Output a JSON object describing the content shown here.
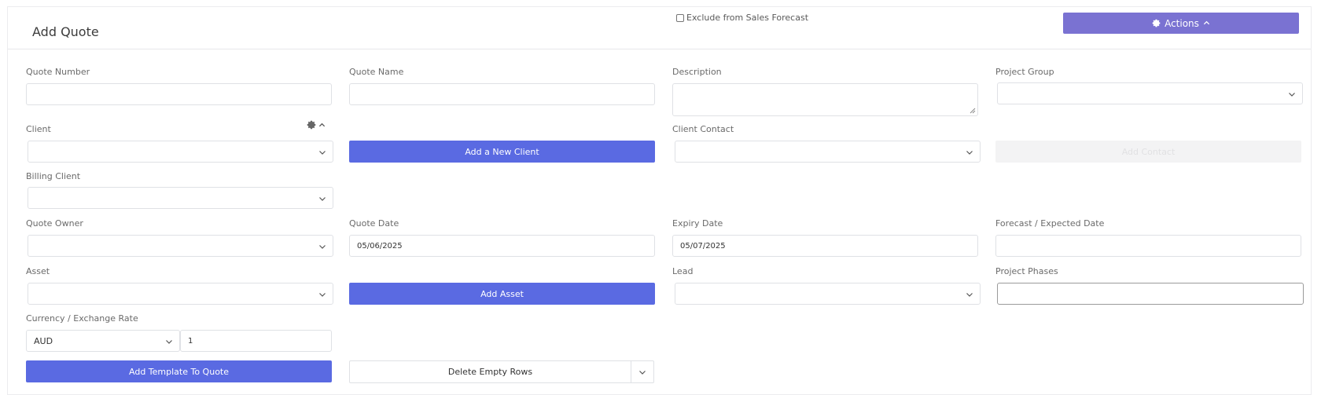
{
  "page": {
    "title": "Add Quote"
  },
  "header": {
    "exclude_label": "Exclude from Sales Forecast",
    "exclude_checked": false,
    "actions_label": "Actions"
  },
  "form": {
    "quote_number": {
      "label": "Quote Number",
      "value": ""
    },
    "quote_name": {
      "label": "Quote Name",
      "value": ""
    },
    "description": {
      "label": "Description",
      "value": ""
    },
    "project_group": {
      "label": "Project Group",
      "value": ""
    },
    "client": {
      "label": "Client",
      "value": ""
    },
    "add_client_label": "Add a New Client",
    "client_contact": {
      "label": "Client Contact",
      "value": ""
    },
    "add_contact_label": "Add Contact",
    "billing_client": {
      "label": "Billing Client",
      "value": ""
    },
    "quote_owner": {
      "label": "Quote Owner",
      "value": ""
    },
    "quote_date": {
      "label": "Quote Date",
      "value": "05/06/2025"
    },
    "expiry_date": {
      "label": "Expiry Date",
      "value": "05/07/2025"
    },
    "forecast_date": {
      "label": "Forecast / Expected Date",
      "value": ""
    },
    "asset": {
      "label": "Asset",
      "value": ""
    },
    "add_asset_label": "Add Asset",
    "lead": {
      "label": "Lead",
      "value": ""
    },
    "project_phases": {
      "label": "Project Phases",
      "value": ""
    },
    "currency": {
      "label": "Currency / Exchange Rate",
      "value": "AUD",
      "rate": "1"
    },
    "add_template_label": "Add Template To Quote",
    "delete_empty_rows_label": "Delete Empty Rows"
  },
  "colors": {
    "actions": "#7a72d2",
    "primary_button": "#5a6ae2"
  },
  "icons": [
    "gear-icon",
    "chevron-up-icon",
    "chevron-down-icon"
  ]
}
